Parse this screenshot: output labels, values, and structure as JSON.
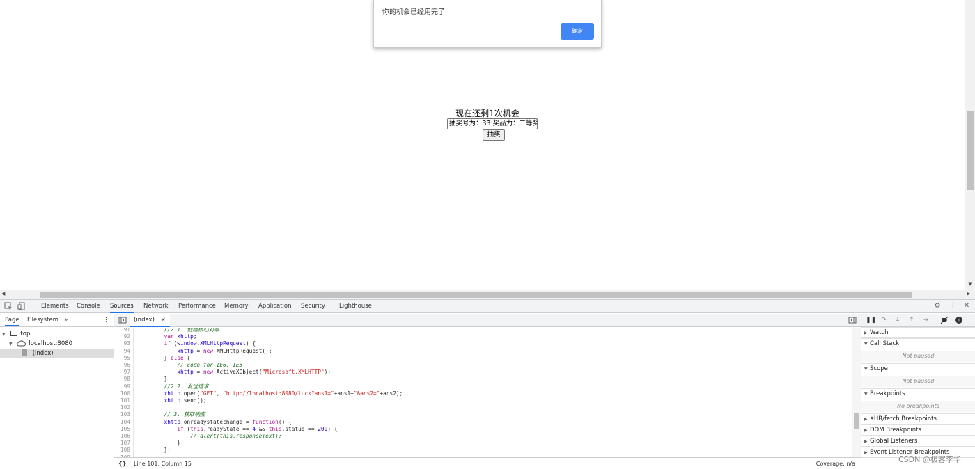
{
  "page": {
    "alert": {
      "message": "你的机会已经用完了",
      "ok_label": "确定"
    },
    "remaining_text": "现在还剩1次机会",
    "result_value": "抽奖号为：33 奖品为：二等奖",
    "draw_button": "抽奖"
  },
  "devtools": {
    "tabs": [
      "Elements",
      "Console",
      "Sources",
      "Network",
      "Performance",
      "Memory",
      "Application",
      "Security",
      "Lighthouse"
    ],
    "active_tab": "Sources",
    "sidebar": {
      "tabs": [
        "Page",
        "Filesystem"
      ],
      "more": "»",
      "tree": {
        "top": "top",
        "host": "localhost:8080",
        "file": "(index)"
      }
    },
    "editor": {
      "file_tab": "(index)",
      "close": "×",
      "lines": [
        {
          "n": "91",
          "indent": "        ",
          "tokens": [
            [
              "c-cm",
              "//2.1. 创建核心对象"
            ]
          ]
        },
        {
          "n": "92",
          "indent": "        ",
          "tokens": [
            [
              "c-kw",
              "var"
            ],
            [
              "c-pl",
              " "
            ],
            [
              "c-id",
              "xhttp"
            ],
            [
              "c-pl",
              ";"
            ]
          ]
        },
        {
          "n": "93",
          "indent": "        ",
          "tokens": [
            [
              "c-kw",
              "if"
            ],
            [
              "c-pl",
              " ("
            ],
            [
              "c-id",
              "window"
            ],
            [
              "c-pl",
              "."
            ],
            [
              "c-id",
              "XMLHttpRequest"
            ],
            [
              "c-pl",
              ") {"
            ]
          ]
        },
        {
          "n": "94",
          "indent": "            ",
          "tokens": [
            [
              "c-id",
              "xhttp"
            ],
            [
              "c-pl",
              " = "
            ],
            [
              "c-kw",
              "new"
            ],
            [
              "c-pl",
              " XMLHttpRequest();"
            ]
          ]
        },
        {
          "n": "95",
          "indent": "        ",
          "tokens": [
            [
              "c-pl",
              "} "
            ],
            [
              "c-kw",
              "else"
            ],
            [
              "c-pl",
              " {"
            ]
          ]
        },
        {
          "n": "96",
          "indent": "            ",
          "tokens": [
            [
              "c-cm",
              "// code for IE6, IE5"
            ]
          ]
        },
        {
          "n": "97",
          "indent": "            ",
          "tokens": [
            [
              "c-id",
              "xhttp"
            ],
            [
              "c-pl",
              " = "
            ],
            [
              "c-kw",
              "new"
            ],
            [
              "c-pl",
              " ActiveXObject("
            ],
            [
              "c-st",
              "\"Microsoft.XMLHTTP\""
            ],
            [
              "c-pl",
              ");"
            ]
          ]
        },
        {
          "n": "98",
          "indent": "        ",
          "tokens": [
            [
              "c-pl",
              "}"
            ]
          ]
        },
        {
          "n": "99",
          "indent": "        ",
          "tokens": [
            [
              "c-cm",
              "//2.2. 发送请求"
            ]
          ]
        },
        {
          "n": "100",
          "indent": "        ",
          "tokens": [
            [
              "c-id",
              "xhttp"
            ],
            [
              "c-pl",
              ".open("
            ],
            [
              "c-st",
              "\"GET\""
            ],
            [
              "c-pl",
              ", "
            ],
            [
              "c-st",
              "\"http://localhost:8080/luck?ans1=\""
            ],
            [
              "c-pl",
              "+ans1+"
            ],
            [
              "c-st",
              "\"&ans2=\""
            ],
            [
              "c-pl",
              "+ans2);"
            ]
          ]
        },
        {
          "n": "101",
          "indent": "        ",
          "tokens": [
            [
              "c-id",
              "xhttp"
            ],
            [
              "c-pl",
              ".send();"
            ]
          ]
        },
        {
          "n": "102",
          "indent": "",
          "tokens": []
        },
        {
          "n": "103",
          "indent": "        ",
          "tokens": [
            [
              "c-cm",
              "// 3. 获取响应"
            ]
          ]
        },
        {
          "n": "104",
          "indent": "        ",
          "tokens": [
            [
              "c-id",
              "xhttp"
            ],
            [
              "c-pl",
              ".onreadystatechange = "
            ],
            [
              "c-kw",
              "function"
            ],
            [
              "c-pl",
              "() {"
            ]
          ]
        },
        {
          "n": "105",
          "indent": "            ",
          "tokens": [
            [
              "c-kw",
              "if"
            ],
            [
              "c-pl",
              " ("
            ],
            [
              "c-kw",
              "this"
            ],
            [
              "c-pl",
              ".readyState == "
            ],
            [
              "c-id",
              "4"
            ],
            [
              "c-pl",
              " && "
            ],
            [
              "c-kw",
              "this"
            ],
            [
              "c-pl",
              ".status == "
            ],
            [
              "c-id",
              "200"
            ],
            [
              "c-pl",
              ") {"
            ]
          ]
        },
        {
          "n": "106",
          "indent": "                ",
          "tokens": [
            [
              "c-cm",
              "// alert(this.responseText);"
            ]
          ]
        },
        {
          "n": "107",
          "indent": "            ",
          "tokens": [
            [
              "c-pl",
              "}"
            ]
          ]
        },
        {
          "n": "108",
          "indent": "        ",
          "tokens": [
            [
              "c-pl",
              "};"
            ]
          ]
        },
        {
          "n": "109",
          "indent": "",
          "tokens": []
        }
      ],
      "status_left": "Line 101, Column 15",
      "status_right": "Coverage: n/a",
      "format_icon": "{}"
    },
    "debugger": {
      "sections": [
        {
          "label": "Watch",
          "expanded": false
        },
        {
          "label": "Call Stack",
          "expanded": true,
          "empty": "Not paused"
        },
        {
          "label": "Scope",
          "expanded": true,
          "empty": "Not paused"
        },
        {
          "label": "Breakpoints",
          "expanded": true,
          "empty": "No breakpoints"
        },
        {
          "label": "XHR/fetch Breakpoints",
          "expanded": false
        },
        {
          "label": "DOM Breakpoints",
          "expanded": false
        },
        {
          "label": "Global Listeners",
          "expanded": false
        },
        {
          "label": "Event Listener Breakpoints",
          "expanded": false
        }
      ]
    }
  },
  "watermark": "CSDN @极客李华",
  "colors": {
    "accent": "#1a73e8",
    "alert_button": "#4285f4"
  }
}
